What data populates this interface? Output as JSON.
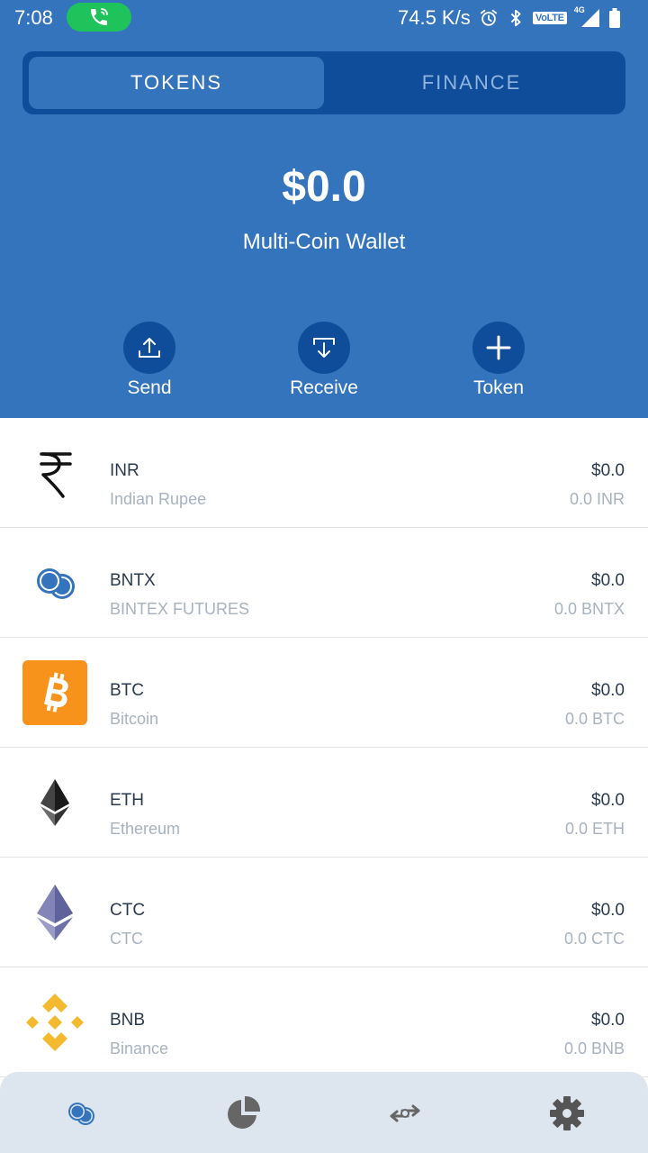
{
  "status_bar": {
    "time": "7:08",
    "network_speed": "74.5 K/s",
    "volte": "VoLTE",
    "network_type": "4G",
    "icons": [
      "call-active-icon",
      "alarm-icon",
      "bluetooth-icon",
      "signal-icon",
      "battery-icon"
    ]
  },
  "tabs": [
    {
      "label": "TOKENS",
      "active": true
    },
    {
      "label": "FINANCE",
      "active": false
    }
  ],
  "wallet": {
    "balance": "$0.0",
    "name": "Multi-Coin Wallet"
  },
  "actions": [
    {
      "label": "Send",
      "icon": "upload-icon"
    },
    {
      "label": "Receive",
      "icon": "download-icon"
    },
    {
      "label": "Token",
      "icon": "plus-icon"
    }
  ],
  "tokens": [
    {
      "symbol": "INR",
      "name": "Indian Rupee",
      "fiat": "$0.0",
      "amount": "0.0 INR",
      "icon": "rupee-icon"
    },
    {
      "symbol": "BNTX",
      "name": "BINTEX FUTURES",
      "fiat": "$0.0",
      "amount": "0.0 BNTX",
      "icon": "bntx-icon"
    },
    {
      "symbol": "BTC",
      "name": "Bitcoin",
      "fiat": "$0.0",
      "amount": "0.0 BTC",
      "icon": "bitcoin-icon"
    },
    {
      "symbol": "ETH",
      "name": "Ethereum",
      "fiat": "$0.0",
      "amount": "0.0 ETH",
      "icon": "ethereum-icon"
    },
    {
      "symbol": "CTC",
      "name": "CTC",
      "fiat": "$0.0",
      "amount": "0.0 CTC",
      "icon": "ctc-icon"
    },
    {
      "symbol": "BNB",
      "name": "Binance",
      "fiat": "$0.0",
      "amount": "0.0 BNB",
      "icon": "binance-icon"
    }
  ],
  "bottom_nav": [
    "wallet-icon",
    "pie-chart-icon",
    "swap-icon",
    "settings-icon"
  ],
  "colors": {
    "primary": "#3474bd",
    "primary_dark": "#0f4d9a",
    "bitcoin": "#f7931a",
    "binance": "#f3ba2f",
    "call_active": "#1ec35b"
  }
}
